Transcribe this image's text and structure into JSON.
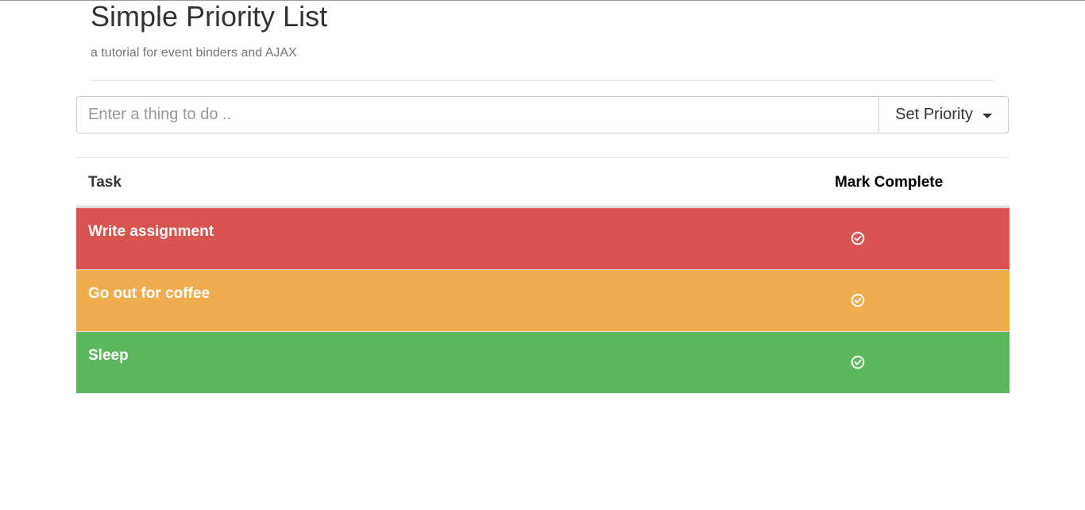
{
  "header": {
    "title": "Simple Priority List",
    "subtitle": "a tutorial for event binders and AJAX"
  },
  "form": {
    "task_placeholder": "Enter a thing to do ..",
    "task_value": "",
    "priority_button_label": "Set Priority"
  },
  "table": {
    "columns": [
      "Task",
      "Mark Complete"
    ],
    "rows": [
      {
        "task": "Write assignment",
        "priority_color": "#d9534f",
        "complete_icon": "check-circle-icon"
      },
      {
        "task": "Go out for coffee",
        "priority_color": "#f0ad4e",
        "complete_icon": "check-circle-icon"
      },
      {
        "task": "Sleep",
        "priority_color": "#5cb85c",
        "complete_icon": "check-circle-icon"
      }
    ]
  },
  "colors": {
    "high": "#d9534f",
    "medium": "#f0ad4e",
    "low": "#5cb85c"
  }
}
